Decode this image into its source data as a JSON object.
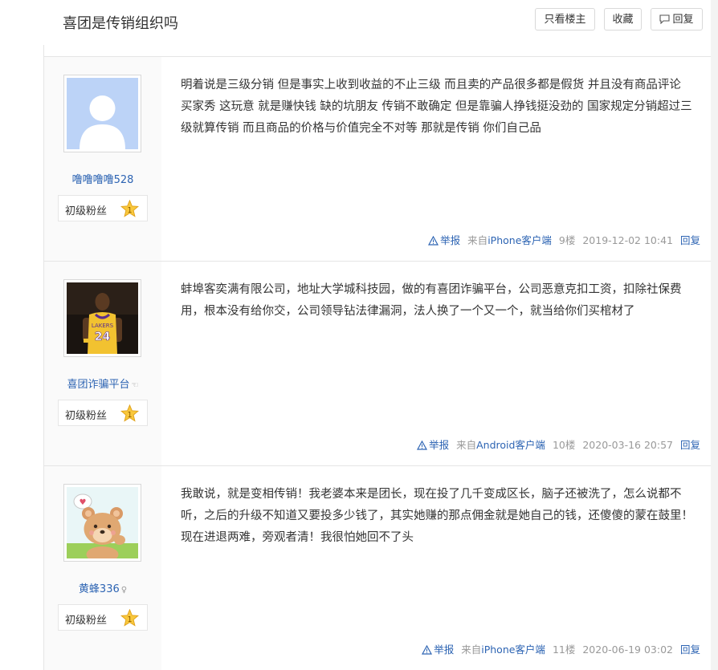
{
  "header": {
    "title": "喜团是传销组织吗",
    "only_op_label": "只看楼主",
    "favorite_label": "收藏",
    "reply_label": "回复"
  },
  "posts": [
    {
      "username": "噜噜噜噜528",
      "avatar_icon": "default-avatar",
      "level_label": "初级粉丝",
      "level": "1",
      "content": "明着说是三级分销 但是事实上收到收益的不止三级 而且卖的产品很多都是假货 并且没有商品评论 买家秀 这玩意 就是赚快钱 缺的坑朋友 传销不敢确定 但是靠骗人挣钱挺没劲的 国家规定分销超过三级就算传销 而且商品的价格与价值完全不对等 那就是传销 你们自己品",
      "report_label": "举报",
      "client_prefix": "来自",
      "client": "iPhone客户端",
      "floor": "9楼",
      "time": "2019-12-02 10:41",
      "reply_label": "回复"
    },
    {
      "username": "喜团诈骗平台",
      "username_mark": "☜",
      "avatar_icon": "basketball-player-avatar",
      "level_label": "初级粉丝",
      "level": "1",
      "content": "蚌埠客奕满有限公司，地址大学城科技园，做的有喜团诈骗平台，公司恶意克扣工资，扣除社保费用，根本没有给你交，公司领导钻法律漏洞，法人换了一个又一个，就当给你们买棺材了",
      "report_label": "举报",
      "client_prefix": "来自",
      "client": "Android客户端",
      "floor": "10楼",
      "time": "2020-03-16 20:57",
      "reply_label": "回复"
    },
    {
      "username": "黄蜂336",
      "username_mark": "♀",
      "avatar_icon": "cartoon-bear-avatar",
      "level_label": "初级粉丝",
      "level": "1",
      "content": "我敢说，就是变相传销！我老婆本来是团长，现在投了几千变成区长，脑子还被洗了，怎么说都不听，之后的升级不知道又要投多少钱了，其实她赚的那点佣金就是她自己的钱，还傻傻的蒙在鼓里！现在进退两难，旁观者清！我很怕她回不了头",
      "report_label": "举报",
      "client_prefix": "来自",
      "client": "iPhone客户端",
      "floor": "11楼",
      "time": "2020-06-19 03:02",
      "reply_label": "回复"
    }
  ],
  "colors": {
    "link": "#2d64b3",
    "meta": "#999999",
    "sidebar": "#fafafa",
    "border": "#e5e5e5"
  }
}
